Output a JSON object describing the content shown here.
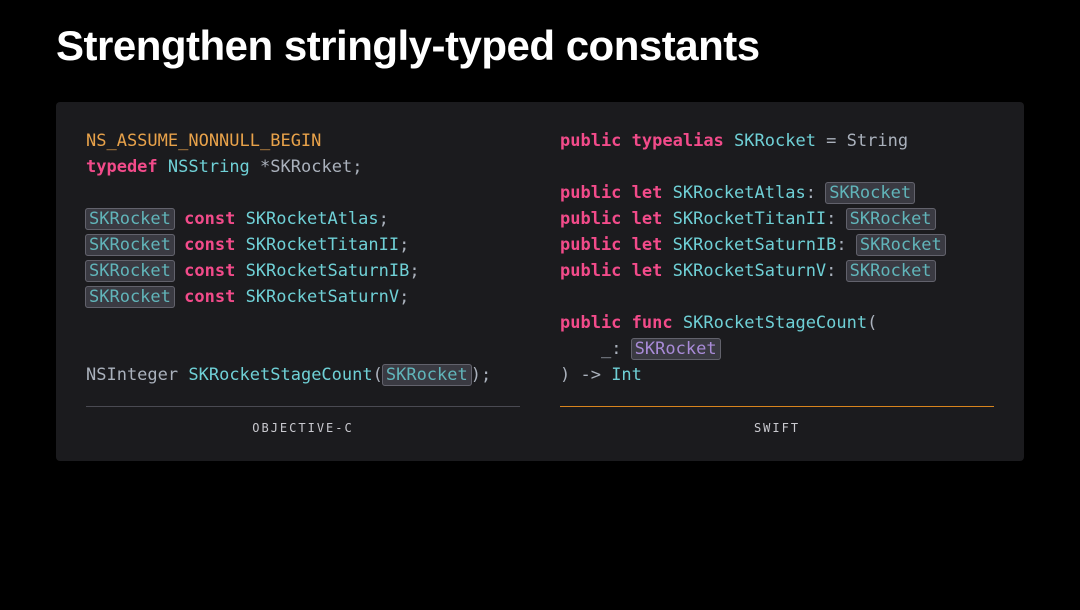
{
  "slide": {
    "title": "Strengthen stringly-typed constants"
  },
  "objc": {
    "label": "OBJECTIVE-C",
    "macro": "NS_ASSUME_NONNULL_BEGIN",
    "typedef_kw": "typedef",
    "nsstring": "NSString",
    "star": "*",
    "rocket_type": "SKRocket",
    "semicolon": ";",
    "const_kw": "const",
    "consts": [
      "SKRocketAtlas",
      "SKRocketTitanII",
      "SKRocketSaturnIB",
      "SKRocketSaturnV"
    ],
    "nsinteger": "NSInteger",
    "func": "SKRocketStageCount",
    "param_type": "SKRocket",
    "open_paren": "(",
    "close_paren_semi": ");"
  },
  "swift": {
    "label": "SWIFT",
    "public_kw": "public",
    "typealias_kw": "typealias",
    "rocket_type": "SKRocket",
    "equals": " = ",
    "string": "String",
    "let_kw": "let",
    "colon": ": ",
    "consts": [
      "SKRocketAtlas",
      "SKRocketTitanII",
      "SKRocketSaturnIB",
      "SKRocketSaturnV"
    ],
    "func_kw": "func",
    "func_name": "SKRocketStageCount",
    "open_paren": "(",
    "underscore_colon": "_: ",
    "close_arrow": ") -> ",
    "int_type": "Int"
  }
}
